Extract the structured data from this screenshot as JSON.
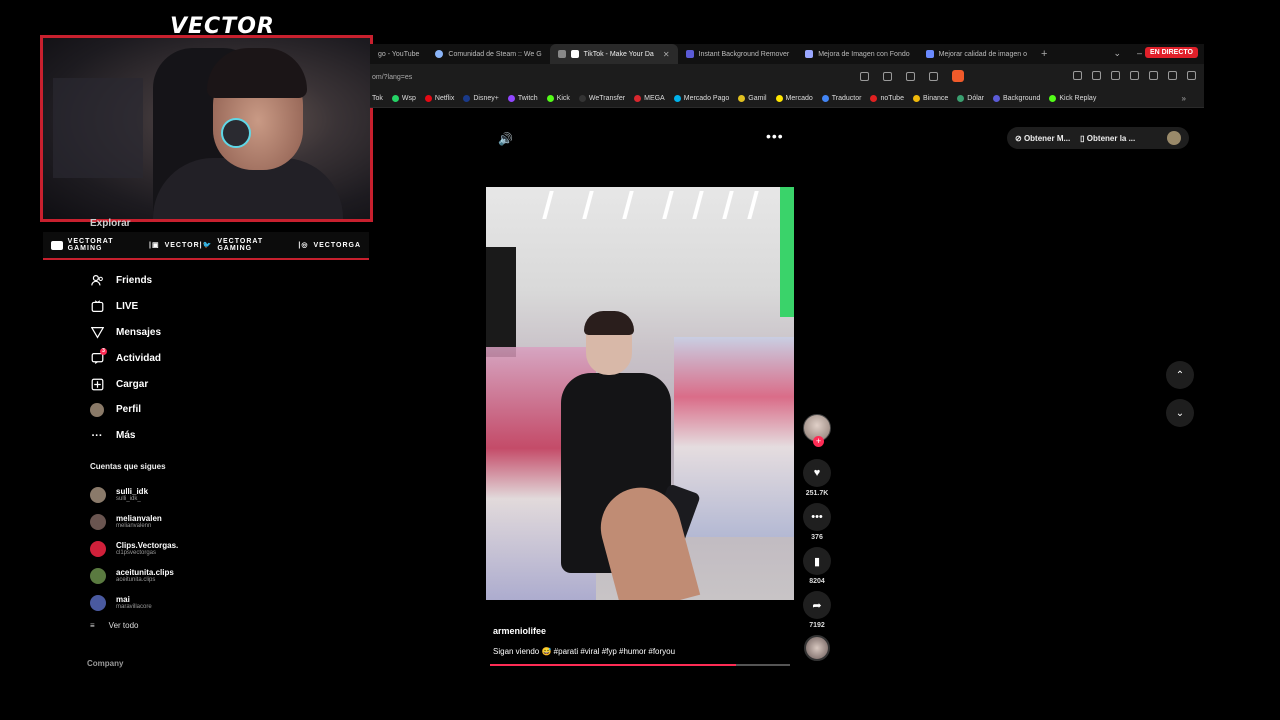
{
  "overlay": {
    "brand": "VECTOR",
    "socials": [
      {
        "icon": "youtube-icon",
        "label": "VECTORAT GAMING"
      },
      {
        "icon": "twitch-icon",
        "label": "VECTOR"
      },
      {
        "icon": "twitter-icon",
        "label": "VECTORAT GAMING"
      },
      {
        "icon": "instagram-icon",
        "label": "VECTORGA"
      }
    ]
  },
  "browser": {
    "tabs": [
      {
        "label": "go - YouTube",
        "color": "#e02020",
        "active": false
      },
      {
        "label": "Comunidad de Steam :: We G",
        "color": "#8ab4f8",
        "active": false
      },
      {
        "label": "TikTok - Make Your Da",
        "color": "#ffffff",
        "active": true
      },
      {
        "label": "Instant Background Remover",
        "color": "#5b5bd6",
        "active": false
      },
      {
        "label": "Mejora de Imagen con Fondo",
        "color": "#9aa7ff",
        "active": false
      },
      {
        "label": "Mejorar calidad de imagen o",
        "color": "#6a8aff",
        "active": false
      }
    ],
    "live_badge": "EN DIRECTO",
    "url": "om/?lang=es",
    "bookmarks": [
      {
        "label": "Tok",
        "color": "#ffffff"
      },
      {
        "label": "Wsp",
        "color": "#25d366"
      },
      {
        "label": "Netflix",
        "color": "#e50914"
      },
      {
        "label": "Disney+",
        "color": "#1a3a8a"
      },
      {
        "label": "Twitch",
        "color": "#9146ff"
      },
      {
        "label": "Kick",
        "color": "#53fc18"
      },
      {
        "label": "WeTransfer",
        "color": "#cccccc"
      },
      {
        "label": "MEGA",
        "color": "#d9272e"
      },
      {
        "label": "Mercado Pago",
        "color": "#00b1ea"
      },
      {
        "label": "Gamil",
        "color": "#e0c020"
      },
      {
        "label": "Mercado",
        "color": "#ffe600"
      },
      {
        "label": "Traductor",
        "color": "#4285f4"
      },
      {
        "label": "noTube",
        "color": "#e02020"
      },
      {
        "label": "Binance",
        "color": "#f0b90b"
      },
      {
        "label": "Dólar",
        "color": "#3aa070"
      },
      {
        "label": "Background",
        "color": "#5b5bd6"
      },
      {
        "label": "Kick Replay",
        "color": "#53fc18"
      }
    ]
  },
  "sidebar": {
    "explore_label": "Explorar",
    "items": [
      {
        "label": "Friends",
        "icon": "friends-icon"
      },
      {
        "label": "LIVE",
        "icon": "live-icon"
      },
      {
        "label": "Mensajes",
        "icon": "messages-icon"
      },
      {
        "label": "Actividad",
        "icon": "activity-icon",
        "badge": "3"
      },
      {
        "label": "Cargar",
        "icon": "upload-icon"
      },
      {
        "label": "Perfil",
        "icon": "profile-avatar"
      },
      {
        "label": "Más",
        "icon": "more-icon"
      }
    ],
    "following_title": "Cuentas que sigues",
    "following": [
      {
        "name": "sulli_idk",
        "username": "sulli_idk_",
        "color": "#8a7a6a"
      },
      {
        "name": "melianvalen",
        "username": "melianvalenn",
        "color": "#6a5550"
      },
      {
        "name": "Clips.Vectorgas.",
        "username": "cl1psvectorgas",
        "color": "#d0203a"
      },
      {
        "name": "aceitunita.clips",
        "username": "aceitunita.clips",
        "color": "#5a7a40"
      },
      {
        "name": "mai",
        "username": "maravillacore",
        "color": "#4a5aa0"
      }
    ],
    "see_all": "Ver todo",
    "company": "Company"
  },
  "top_buttons": {
    "get_app": "Obtener M...",
    "get_app2": "Obtener la ..."
  },
  "video": {
    "author": "armeniolifee",
    "caption": "Sigan viendo 😅 #parati #viral #fyp #humor #foryou",
    "progress": 0.82,
    "likes": "251.7K",
    "comments": "376",
    "saves": "8204",
    "shares": "7192"
  }
}
